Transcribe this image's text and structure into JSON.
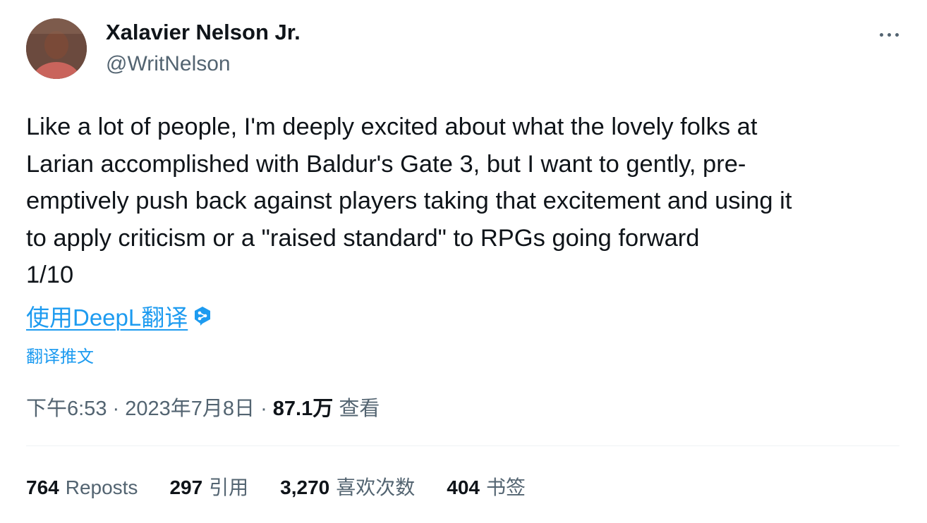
{
  "author": {
    "name": "Xalavier Nelson Jr.",
    "handle": "@WritNelson"
  },
  "tweet": {
    "lines": [
      "Like a lot of people, I'm deeply excited about what the lovely folks at",
      "Larian accomplished with Baldur's Gate 3, but I want to gently, pre-",
      "emptively push back against players taking that excitement and using it",
      "to apply criticism or a \"raised standard\" to RPGs going forward",
      "1/10"
    ]
  },
  "translate": {
    "deepl_label": "使用DeepL翻译",
    "deepl_icon": "deepl-icon",
    "translate_post_label": "翻译推文"
  },
  "meta": {
    "time": "下午6:53",
    "separator": "·",
    "date": "2023年7月8日",
    "views_count": "87.1万",
    "views_label": "查看"
  },
  "stats": {
    "reposts_count": "764",
    "reposts_label": "Reposts",
    "quotes_count": "297",
    "quotes_label": "引用",
    "likes_count": "3,270",
    "likes_label": "喜欢次数",
    "bookmarks_count": "404",
    "bookmarks_label": "书签"
  },
  "colors": {
    "text_primary": "#0f1419",
    "text_secondary": "#536471",
    "accent": "#1d9bf0",
    "divider": "#eff3f4"
  }
}
